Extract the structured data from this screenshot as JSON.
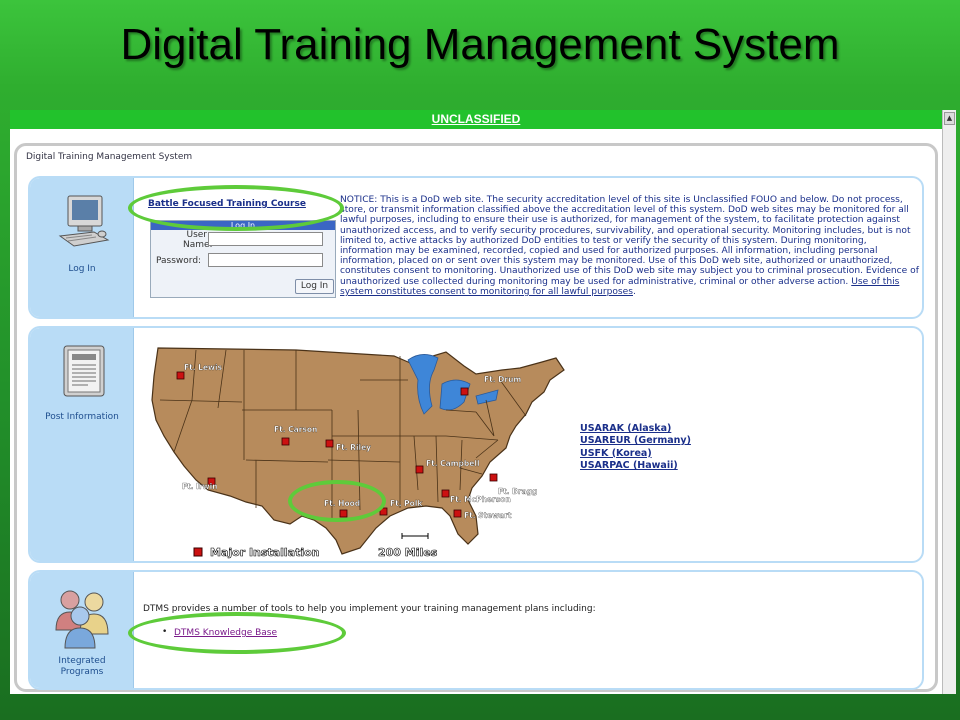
{
  "slide": {
    "title": "Digital Training Management System"
  },
  "banner": {
    "text": "UNCLASSIFIED"
  },
  "frame": {
    "title": "Digital Training Management System"
  },
  "login_panel": {
    "side_label": "Log In",
    "icon": "computer-icon",
    "bftc_link": "Battle Focused Training Course",
    "box_header": "Log In",
    "user_label_line1": "User",
    "user_label_line2": "Name:",
    "password_label": "Password:",
    "user_value": "",
    "password_value": "",
    "button": "Log In"
  },
  "notice": {
    "text": "NOTICE: This is a DoD web site. The security accreditation level of this site is Unclassified FOUO and below. Do not process, store, or transmit information classified above the accreditation level of this system. DoD web sites may be monitored for all lawful purposes, including to ensure their use is authorized, for management of the system, to facilitate protection against unauthorized access, and to verify security procedures, survivability, and operational security. Monitoring includes, but is not limited to, active attacks by authorized DoD entities to test or verify the security of this system. During monitoring, information may be examined, recorded, copied and used for authorized purposes. All information, including personal information, placed on or sent over this system may be monitored. Use of this DoD web site, authorized or unauthorized, constitutes consent to monitoring. Unauthorized use of this DoD web site may subject you to criminal prosecution. Evidence of unauthorized use collected during monitoring may be used for administrative, criminal or other adverse action.",
    "consent": "Use of this system constitutes consent to monitoring for all lawful purposes",
    "consent_period": "."
  },
  "post_panel": {
    "side_label": "Post Information",
    "icon": "newspaper-icon",
    "map_icon": "us-map",
    "installations": [
      "Ft. Lewis",
      "Ft. Drum",
      "Ft. Carson",
      "Ft. Riley",
      "Ft. Campbell",
      "Ft. Irwin",
      "Ft. Bragg",
      "Ft. McPherson",
      "Ft. Hood",
      "Ft. Polk",
      "Ft. Stewart"
    ],
    "legend_major": "Major Installation",
    "legend_scale": "200 Miles",
    "marker_color": "#cc1111",
    "overseas_links": [
      "USARAK (Alaska)",
      "USAREUR (Germany)",
      "USFK (Korea)",
      "USARPAC (Hawaii)"
    ]
  },
  "programs_panel": {
    "side_label_line1": "Integrated",
    "side_label_line2": "Programs",
    "icon": "people-icon",
    "intro": "DTMS provides a number of tools to help you implement your training management plans including:",
    "bullet": "•",
    "kb_link": "DTMS Knowledge Base"
  },
  "colors": {
    "slide_green": "#2fae2f",
    "banner_green": "#22c22c",
    "side_blue": "#b9dcf6",
    "link_blue": "#1a2f8a",
    "map_tan": "#b78b5c",
    "highlight_green": "#5ecb3a"
  }
}
